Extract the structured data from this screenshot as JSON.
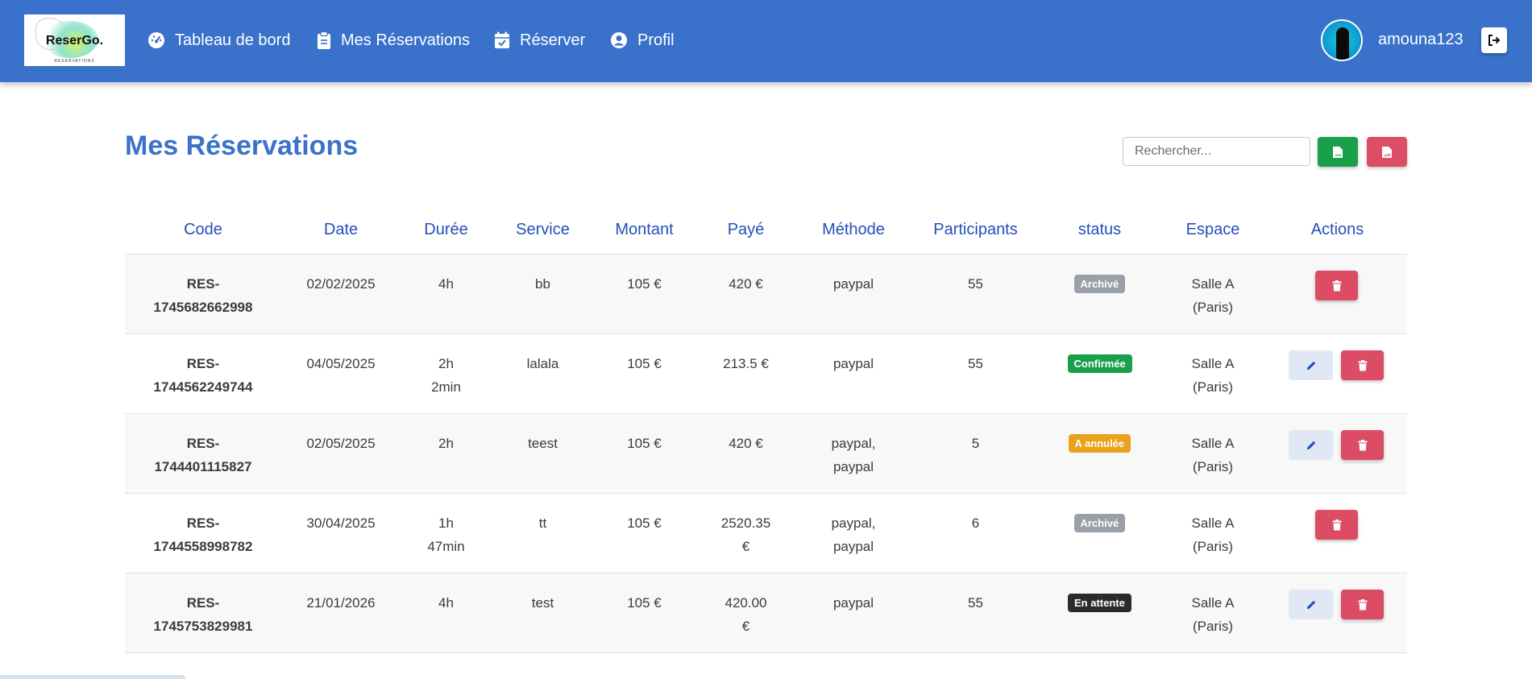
{
  "app": {
    "logo_text": "ReserGo.",
    "logo_sub": "RESERVATIONS"
  },
  "nav": {
    "items": [
      {
        "label": "Tableau de bord",
        "icon": "gauge-icon"
      },
      {
        "label": "Mes Réservations",
        "icon": "clipboard-icon"
      },
      {
        "label": "Réserver",
        "icon": "calendar-check-icon"
      },
      {
        "label": "Profil",
        "icon": "user-circle-icon"
      }
    ],
    "username": "amouna123"
  },
  "page": {
    "title": "Mes Réservations",
    "search_placeholder": "Rechercher...",
    "export_csv": "csv",
    "export_pdf": "pdf"
  },
  "table": {
    "headers": [
      "Code",
      "Date",
      "Durée",
      "Service",
      "Montant",
      "Payé",
      "Méthode",
      "Participants",
      "status",
      "Espace",
      "Actions"
    ],
    "rows": [
      {
        "code1": "RES-",
        "code2": "1745682662998",
        "date": "02/02/2025",
        "dur1": "4h",
        "dur2": "",
        "service": "bb",
        "montant": "105 €",
        "paye1": "420 €",
        "paye2": "",
        "methode1": "paypal",
        "methode2": "",
        "participants": "55",
        "status": "Archivé",
        "status_color": "#9aa0a8",
        "espace1": "Salle A",
        "espace2": "(Paris)",
        "editable": false
      },
      {
        "code1": "RES-",
        "code2": "1744562249744",
        "date": "04/05/2025",
        "dur1": "2h",
        "dur2": "2min",
        "service": "lalala",
        "montant": "105 €",
        "paye1": "213.5 €",
        "paye2": "",
        "methode1": "paypal",
        "methode2": "",
        "participants": "55",
        "status": "Confirmée",
        "status_color": "#1aa04a",
        "espace1": "Salle A",
        "espace2": "(Paris)",
        "editable": true
      },
      {
        "code1": "RES-",
        "code2": "1744401115827",
        "date": "02/05/2025",
        "dur1": "2h",
        "dur2": "",
        "service": "teest",
        "montant": "105 €",
        "paye1": "420 €",
        "paye2": "",
        "methode1": "paypal,",
        "methode2": "paypal",
        "participants": "5",
        "status": "A annulée",
        "status_color": "#e8a21b",
        "espace1": "Salle A",
        "espace2": "(Paris)",
        "editable": true
      },
      {
        "code1": "RES-",
        "code2": "1744558998782",
        "date": "30/04/2025",
        "dur1": "1h",
        "dur2": "47min",
        "service": "tt",
        "montant": "105 €",
        "paye1": "2520.35",
        "paye2": "€",
        "methode1": "paypal,",
        "methode2": "paypal",
        "participants": "6",
        "status": "Archivé",
        "status_color": "#9aa0a8",
        "espace1": "Salle A",
        "espace2": "(Paris)",
        "editable": false
      },
      {
        "code1": "RES-",
        "code2": "1745753829981",
        "date": "21/01/2026",
        "dur1": "4h",
        "dur2": "",
        "service": "test",
        "montant": "105 €",
        "paye1": "420.00",
        "paye2": "€",
        "methode1": "paypal",
        "methode2": "",
        "participants": "55",
        "status": "En attente",
        "status_color": "#2b2b2b",
        "espace1": "Salle A",
        "espace2": "(Paris)",
        "editable": true
      }
    ]
  },
  "colors": {
    "primary": "#3a72cb",
    "header_text": "#2350b8",
    "danger": "#dc4c64",
    "success": "#1aa04a"
  }
}
